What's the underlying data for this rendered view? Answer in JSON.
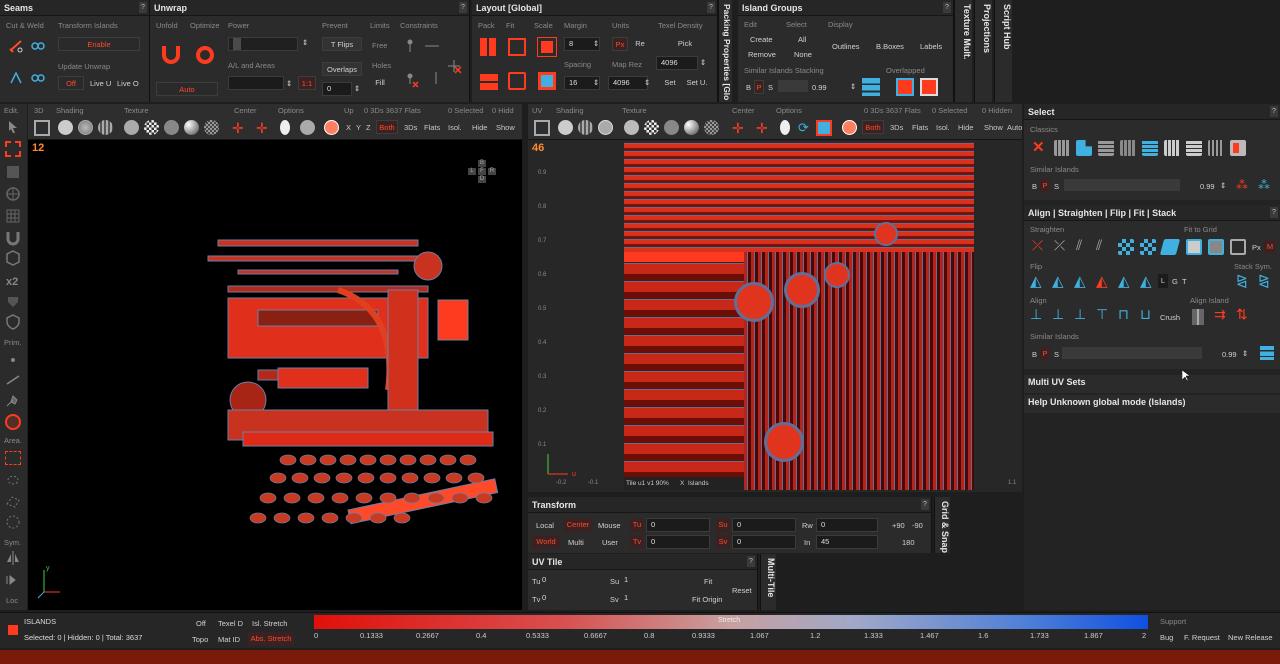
{
  "seams": {
    "title": "Seams",
    "cut_weld": "Cut & Weld",
    "transform_islands": "Transform Islands",
    "enable": "Enable",
    "update_unwrap": "Update Unwrap",
    "off": "Off",
    "live_u": "Live U",
    "live_o": "Live O"
  },
  "unwrap": {
    "title": "Unwrap",
    "unfold": "Unfold",
    "optimize": "Optimize",
    "power": "Power",
    "prevent": "Prevent",
    "limits": "Limits",
    "constraints": "Constraints",
    "t_flips": "T Flips",
    "free": "Free",
    "al_areas": "A/L and Areas",
    "overlaps": "Overlaps",
    "holes": "Holes",
    "fill": "Fill",
    "auto": "Auto",
    "ratio": "1:1",
    "overlap_val": "0"
  },
  "layout": {
    "title": "Layout [Global]",
    "pack": "Pack",
    "fit": "Fit",
    "scale": "Scale",
    "margin": "Margin",
    "margin_val": "8",
    "units": "Units",
    "px": "Px",
    "re": "Re",
    "texel_density": "Texel Density",
    "pick": "Pick",
    "spacing": "Spacing",
    "spacing_val": "16",
    "map_rez": "Map Rez",
    "map_rez_val": "4096",
    "td_val": "4096",
    "set": "Set",
    "set_u": "Set U.",
    "packing_props": "Packing Properties [Glo"
  },
  "island_groups": {
    "title": "Island Groups",
    "edit": "Edit",
    "select": "Select",
    "display": "Display",
    "create": "Create",
    "all": "All",
    "outlines": "Outlines",
    "bboxes": "B.Boxes",
    "labels": "Labels",
    "remove": "Remove",
    "none": "None",
    "similar_stacking": "Similar Islands Stacking",
    "overlapped": "Overlapped",
    "b": "B",
    "p": "P",
    "s": "S",
    "val": "0.99"
  },
  "vtabs": {
    "texture_mult": "Texture Mult.",
    "projections": "Projections",
    "script_hub": "Script Hub"
  },
  "viewport3d": {
    "edit": "Edit.",
    "tab_3d": "3D",
    "shading": "Shading",
    "texture": "Texture",
    "center": "Center",
    "options": "Options",
    "up": "Up",
    "stats": "0 3Ds 3637 Flats",
    "selected": "0 Selected",
    "hidden": "0 Hidd",
    "x": "X",
    "y": "Y",
    "z": "Z",
    "both": "Both",
    "t3ds": "3Ds",
    "flats": "Flats",
    "isol": "Isol.",
    "hide": "Hide",
    "show": "Show",
    "counter": "12",
    "cube": [
      "B",
      "L",
      "F",
      "R",
      "D"
    ]
  },
  "left_tools": {
    "prim": "Prim.",
    "area": "Area.",
    "sym": "Sym.",
    "loc": "Loc",
    "x2": "x2"
  },
  "viewportuv": {
    "uv": "UV",
    "shading": "Shading",
    "texture": "Texture",
    "center": "Center",
    "options": "Options",
    "stats": "0 3Ds 3637 Flats",
    "selected": "0 Selected",
    "hidden": "0 Hidden",
    "both": "Both",
    "t3ds": "3Ds",
    "flats": "Flats",
    "isol": "Isol.",
    "hide": "Hide",
    "show": "Show",
    "auto": "Auto",
    "counter": "46",
    "tile_info": "Tile u1 v1 90%",
    "tile_x": "X",
    "islands": "Islands",
    "ticks_y": [
      "0.9",
      "0.8",
      "0.7",
      "0.6",
      "0.5",
      "0.4",
      "0.3",
      "0.2",
      "0.1"
    ],
    "ticks_x": [
      "-0.2",
      "-0.1",
      "1.1"
    ]
  },
  "transform": {
    "title": "Transform",
    "local": "Local",
    "center": "Center",
    "mouse": "Mouse",
    "tu": "Tu",
    "tu_val": "0",
    "su": "Su",
    "su_val": "0",
    "rw": "Rw",
    "rw_val": "0",
    "p90": "+90",
    "m90": "-90",
    "world": "World",
    "multi": "Multi",
    "user": "User",
    "tv": "Tv",
    "tv_val": "0",
    "sv": "Sv",
    "sv_val": "0",
    "in": "In",
    "in_val": "45",
    "r180": "180",
    "grid_snap": "Grid & Snap"
  },
  "uvtile": {
    "title": "UV Tile",
    "tu": "Tu",
    "tu_val": "0",
    "su": "Su",
    "su_val": "1",
    "fit": "Fit",
    "tv": "Tv",
    "tv_val": "0",
    "sv": "Sv",
    "sv_val": "1",
    "fit_origin": "Fit Origin",
    "reset": "Reset",
    "multi_tile": "Multi-Tile"
  },
  "select": {
    "title": "Select",
    "classics": "Classics",
    "similar": "Similar Islands",
    "b": "B",
    "p": "P",
    "s": "S",
    "val": "0.99"
  },
  "align": {
    "title": "Align | Straighten | Flip | Fit | Stack",
    "straighten": "Straighten",
    "fit_grid": "Fit to Grid",
    "px": "Px",
    "m": "M",
    "flip": "Flip",
    "l": "L",
    "g": "G",
    "t": "T",
    "stack_sym": "Stack Sym.",
    "align": "Align",
    "align_island": "Align Island",
    "crush": "Crush",
    "similar": "Similar Islands",
    "b": "B",
    "p": "P",
    "s": "S",
    "val": "0.99"
  },
  "multi_uv": "Multi UV Sets",
  "help": "Help Unknown global mode (Islands)",
  "status": {
    "mode": "ISLANDS",
    "counts": "Selected: 0 | Hidden: 0 | Total: 3637",
    "off": "Off",
    "texel_d": "Texel D",
    "isl_stretch": "Isl. Stretch",
    "topo": "Topo",
    "mat_id": "Mat ID",
    "abs_stretch": "Abs. Stretch",
    "stretch": "Stretch",
    "ticks": [
      "0",
      "0.1333",
      "0.2667",
      "0.4",
      "0.5333",
      "0.6667",
      "0.8",
      "0.9333",
      "1.067",
      "1.2",
      "1.333",
      "1.467",
      "1.6",
      "1.733",
      "1.867",
      "2"
    ],
    "support": "Support",
    "bug": "Bug",
    "request": "F. Request",
    "new_release": "New Release"
  },
  "colors": {
    "accent": "#ff3b1f",
    "bg": "#1e1e1e",
    "panel": "#2b2b2b",
    "icon_blue": "#3fb0e0"
  }
}
